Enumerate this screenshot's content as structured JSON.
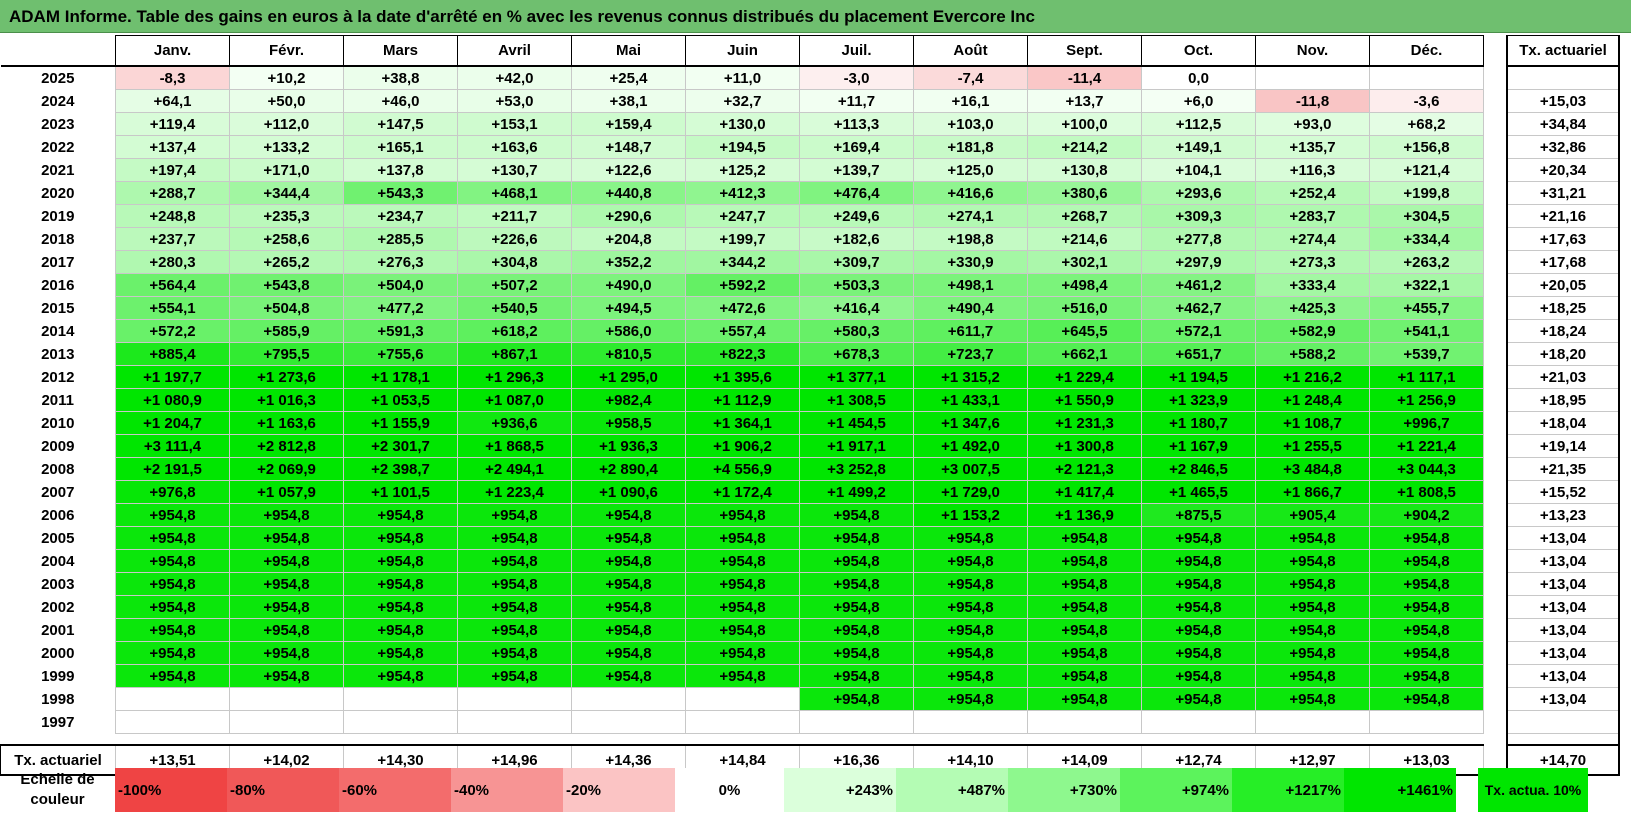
{
  "title": "ADAM Informe. Table des gains en euros à la date d'arrêté en % avec les revenus connus distribués du placement Evercore Inc",
  "months": [
    "Janv.",
    "Févr.",
    "Mars",
    "Avril",
    "Mai",
    "Juin",
    "Juil.",
    "Août",
    "Sept.",
    "Oct.",
    "Nov.",
    "Déc."
  ],
  "tx_header": "Tx. actuariel",
  "rows": [
    {
      "year": "2025",
      "values": [
        "-8,3",
        "+10,2",
        "+38,8",
        "+42,0",
        "+25,4",
        "+11,0",
        "-3,0",
        "-7,4",
        "-11,4",
        "0,0",
        "",
        ""
      ],
      "tx": ""
    },
    {
      "year": "2024",
      "values": [
        "+64,1",
        "+50,0",
        "+46,0",
        "+53,0",
        "+38,1",
        "+32,7",
        "+11,7",
        "+16,1",
        "+13,7",
        "+6,0",
        "-11,8",
        "-3,6"
      ],
      "tx": "+15,03"
    },
    {
      "year": "2023",
      "values": [
        "+119,4",
        "+112,0",
        "+147,5",
        "+153,1",
        "+159,4",
        "+130,0",
        "+113,3",
        "+103,0",
        "+100,0",
        "+112,5",
        "+93,0",
        "+68,2"
      ],
      "tx": "+34,84"
    },
    {
      "year": "2022",
      "values": [
        "+137,4",
        "+133,2",
        "+165,1",
        "+163,6",
        "+148,7",
        "+194,5",
        "+169,4",
        "+181,8",
        "+214,2",
        "+149,1",
        "+135,7",
        "+156,8"
      ],
      "tx": "+32,86"
    },
    {
      "year": "2021",
      "values": [
        "+197,4",
        "+171,0",
        "+137,8",
        "+130,7",
        "+122,6",
        "+125,2",
        "+139,7",
        "+125,0",
        "+130,8",
        "+104,1",
        "+116,3",
        "+121,4"
      ],
      "tx": "+20,34"
    },
    {
      "year": "2020",
      "values": [
        "+288,7",
        "+344,4",
        "+543,3",
        "+468,1",
        "+440,8",
        "+412,3",
        "+476,4",
        "+416,6",
        "+380,6",
        "+293,6",
        "+252,4",
        "+199,8"
      ],
      "tx": "+31,21"
    },
    {
      "year": "2019",
      "values": [
        "+248,8",
        "+235,3",
        "+234,7",
        "+211,7",
        "+290,6",
        "+247,7",
        "+249,6",
        "+274,1",
        "+268,7",
        "+309,3",
        "+283,7",
        "+304,5"
      ],
      "tx": "+21,16"
    },
    {
      "year": "2018",
      "values": [
        "+237,7",
        "+258,6",
        "+285,5",
        "+226,6",
        "+204,8",
        "+199,7",
        "+182,6",
        "+198,8",
        "+214,6",
        "+277,8",
        "+274,4",
        "+334,4"
      ],
      "tx": "+17,63"
    },
    {
      "year": "2017",
      "values": [
        "+280,3",
        "+265,2",
        "+276,3",
        "+304,8",
        "+352,2",
        "+344,2",
        "+309,7",
        "+330,9",
        "+302,1",
        "+297,9",
        "+273,3",
        "+263,2"
      ],
      "tx": "+17,68"
    },
    {
      "year": "2016",
      "values": [
        "+564,4",
        "+543,8",
        "+504,0",
        "+507,2",
        "+490,0",
        "+592,2",
        "+503,3",
        "+498,1",
        "+498,4",
        "+461,2",
        "+333,4",
        "+322,1"
      ],
      "tx": "+20,05"
    },
    {
      "year": "2015",
      "values": [
        "+554,1",
        "+504,8",
        "+477,2",
        "+540,5",
        "+494,5",
        "+472,6",
        "+416,4",
        "+490,4",
        "+516,0",
        "+462,7",
        "+425,3",
        "+455,7"
      ],
      "tx": "+18,25"
    },
    {
      "year": "2014",
      "values": [
        "+572,2",
        "+585,9",
        "+591,3",
        "+618,2",
        "+586,0",
        "+557,4",
        "+580,3",
        "+611,7",
        "+645,5",
        "+572,1",
        "+582,9",
        "+541,1"
      ],
      "tx": "+18,24"
    },
    {
      "year": "2013",
      "values": [
        "+885,4",
        "+795,5",
        "+755,6",
        "+867,1",
        "+810,5",
        "+822,3",
        "+678,3",
        "+723,7",
        "+662,1",
        "+651,7",
        "+588,2",
        "+539,7"
      ],
      "tx": "+18,20"
    },
    {
      "year": "2012",
      "values": [
        "+1 197,7",
        "+1 273,6",
        "+1 178,1",
        "+1 296,3",
        "+1 295,0",
        "+1 395,6",
        "+1 377,1",
        "+1 315,2",
        "+1 229,4",
        "+1 194,5",
        "+1 216,2",
        "+1 117,1"
      ],
      "tx": "+21,03"
    },
    {
      "year": "2011",
      "values": [
        "+1 080,9",
        "+1 016,3",
        "+1 053,5",
        "+1 087,0",
        "+982,4",
        "+1 112,9",
        "+1 308,5",
        "+1 433,1",
        "+1 550,9",
        "+1 323,9",
        "+1 248,4",
        "+1 256,9"
      ],
      "tx": "+18,95"
    },
    {
      "year": "2010",
      "values": [
        "+1 204,7",
        "+1 163,6",
        "+1 155,9",
        "+936,6",
        "+958,5",
        "+1 364,1",
        "+1 454,5",
        "+1 347,6",
        "+1 231,3",
        "+1 180,7",
        "+1 108,7",
        "+996,7"
      ],
      "tx": "+18,04"
    },
    {
      "year": "2009",
      "values": [
        "+3 111,4",
        "+2 812,8",
        "+2 301,7",
        "+1 868,5",
        "+1 936,3",
        "+1 906,2",
        "+1 917,1",
        "+1 492,0",
        "+1 300,8",
        "+1 167,9",
        "+1 255,5",
        "+1 221,4"
      ],
      "tx": "+19,14"
    },
    {
      "year": "2008",
      "values": [
        "+2 191,5",
        "+2 069,9",
        "+2 398,7",
        "+2 494,1",
        "+2 890,4",
        "+4 556,9",
        "+3 252,8",
        "+3 007,5",
        "+2 121,3",
        "+2 846,5",
        "+3 484,8",
        "+3 044,3"
      ],
      "tx": "+21,35"
    },
    {
      "year": "2007",
      "values": [
        "+976,8",
        "+1 057,9",
        "+1 101,5",
        "+1 223,4",
        "+1 090,6",
        "+1 172,4",
        "+1 499,2",
        "+1 729,0",
        "+1 417,4",
        "+1 465,5",
        "+1 866,7",
        "+1 808,5"
      ],
      "tx": "+15,52"
    },
    {
      "year": "2006",
      "values": [
        "+954,8",
        "+954,8",
        "+954,8",
        "+954,8",
        "+954,8",
        "+954,8",
        "+954,8",
        "+1 153,2",
        "+1 136,9",
        "+875,5",
        "+905,4",
        "+904,2"
      ],
      "tx": "+13,23"
    },
    {
      "year": "2005",
      "values": [
        "+954,8",
        "+954,8",
        "+954,8",
        "+954,8",
        "+954,8",
        "+954,8",
        "+954,8",
        "+954,8",
        "+954,8",
        "+954,8",
        "+954,8",
        "+954,8"
      ],
      "tx": "+13,04"
    },
    {
      "year": "2004",
      "values": [
        "+954,8",
        "+954,8",
        "+954,8",
        "+954,8",
        "+954,8",
        "+954,8",
        "+954,8",
        "+954,8",
        "+954,8",
        "+954,8",
        "+954,8",
        "+954,8"
      ],
      "tx": "+13,04"
    },
    {
      "year": "2003",
      "values": [
        "+954,8",
        "+954,8",
        "+954,8",
        "+954,8",
        "+954,8",
        "+954,8",
        "+954,8",
        "+954,8",
        "+954,8",
        "+954,8",
        "+954,8",
        "+954,8"
      ],
      "tx": "+13,04"
    },
    {
      "year": "2002",
      "values": [
        "+954,8",
        "+954,8",
        "+954,8",
        "+954,8",
        "+954,8",
        "+954,8",
        "+954,8",
        "+954,8",
        "+954,8",
        "+954,8",
        "+954,8",
        "+954,8"
      ],
      "tx": "+13,04"
    },
    {
      "year": "2001",
      "values": [
        "+954,8",
        "+954,8",
        "+954,8",
        "+954,8",
        "+954,8",
        "+954,8",
        "+954,8",
        "+954,8",
        "+954,8",
        "+954,8",
        "+954,8",
        "+954,8"
      ],
      "tx": "+13,04"
    },
    {
      "year": "2000",
      "values": [
        "+954,8",
        "+954,8",
        "+954,8",
        "+954,8",
        "+954,8",
        "+954,8",
        "+954,8",
        "+954,8",
        "+954,8",
        "+954,8",
        "+954,8",
        "+954,8"
      ],
      "tx": "+13,04"
    },
    {
      "year": "1999",
      "values": [
        "+954,8",
        "+954,8",
        "+954,8",
        "+954,8",
        "+954,8",
        "+954,8",
        "+954,8",
        "+954,8",
        "+954,8",
        "+954,8",
        "+954,8",
        "+954,8"
      ],
      "tx": "+13,04"
    },
    {
      "year": "1998",
      "values": [
        "",
        "",
        "",
        "",
        "",
        "",
        "+954,8",
        "+954,8",
        "+954,8",
        "+954,8",
        "+954,8",
        "+954,8"
      ],
      "tx": "+13,04"
    },
    {
      "year": "1997",
      "values": [
        "",
        "",
        "",
        "",
        "",
        "",
        "",
        "",
        "",
        "",
        "",
        ""
      ],
      "tx": ""
    }
  ],
  "totals": {
    "label": "Tx. actuariel",
    "values": [
      "+13,51",
      "+14,02",
      "+14,30",
      "+14,96",
      "+14,36",
      "+14,84",
      "+16,36",
      "+14,10",
      "+14,09",
      "+12,74",
      "+12,97",
      "+13,03"
    ],
    "tx": "+14,70"
  },
  "scale": {
    "label": "Echelle de couleur",
    "items": [
      {
        "text": "-100%",
        "color": "#ef4444",
        "align": "left"
      },
      {
        "text": "-80%",
        "color": "#f05858",
        "align": "left"
      },
      {
        "text": "-60%",
        "color": "#f36c6c",
        "align": "left"
      },
      {
        "text": "-40%",
        "color": "#f79494",
        "align": "left"
      },
      {
        "text": "-20%",
        "color": "#fbc4c4",
        "align": "left"
      },
      {
        "text": "0%",
        "color": "#ffffff",
        "align": "center"
      },
      {
        "text": "+243%",
        "color": "#dbffdb",
        "align": "right"
      },
      {
        "text": "+487%",
        "color": "#b4fcb4",
        "align": "right"
      },
      {
        "text": "+730%",
        "color": "#8ef88e",
        "align": "right"
      },
      {
        "text": "+974%",
        "color": "#5cf35c",
        "align": "right"
      },
      {
        "text": "+1217%",
        "color": "#26ee26",
        "align": "right"
      },
      {
        "text": "+1461%",
        "color": "#00e600",
        "align": "right"
      }
    ],
    "tx_label": "Tx. actua. 10%",
    "tx_color": "#00e600"
  },
  "colors": {
    "title_bg": "#6fbf6f"
  }
}
